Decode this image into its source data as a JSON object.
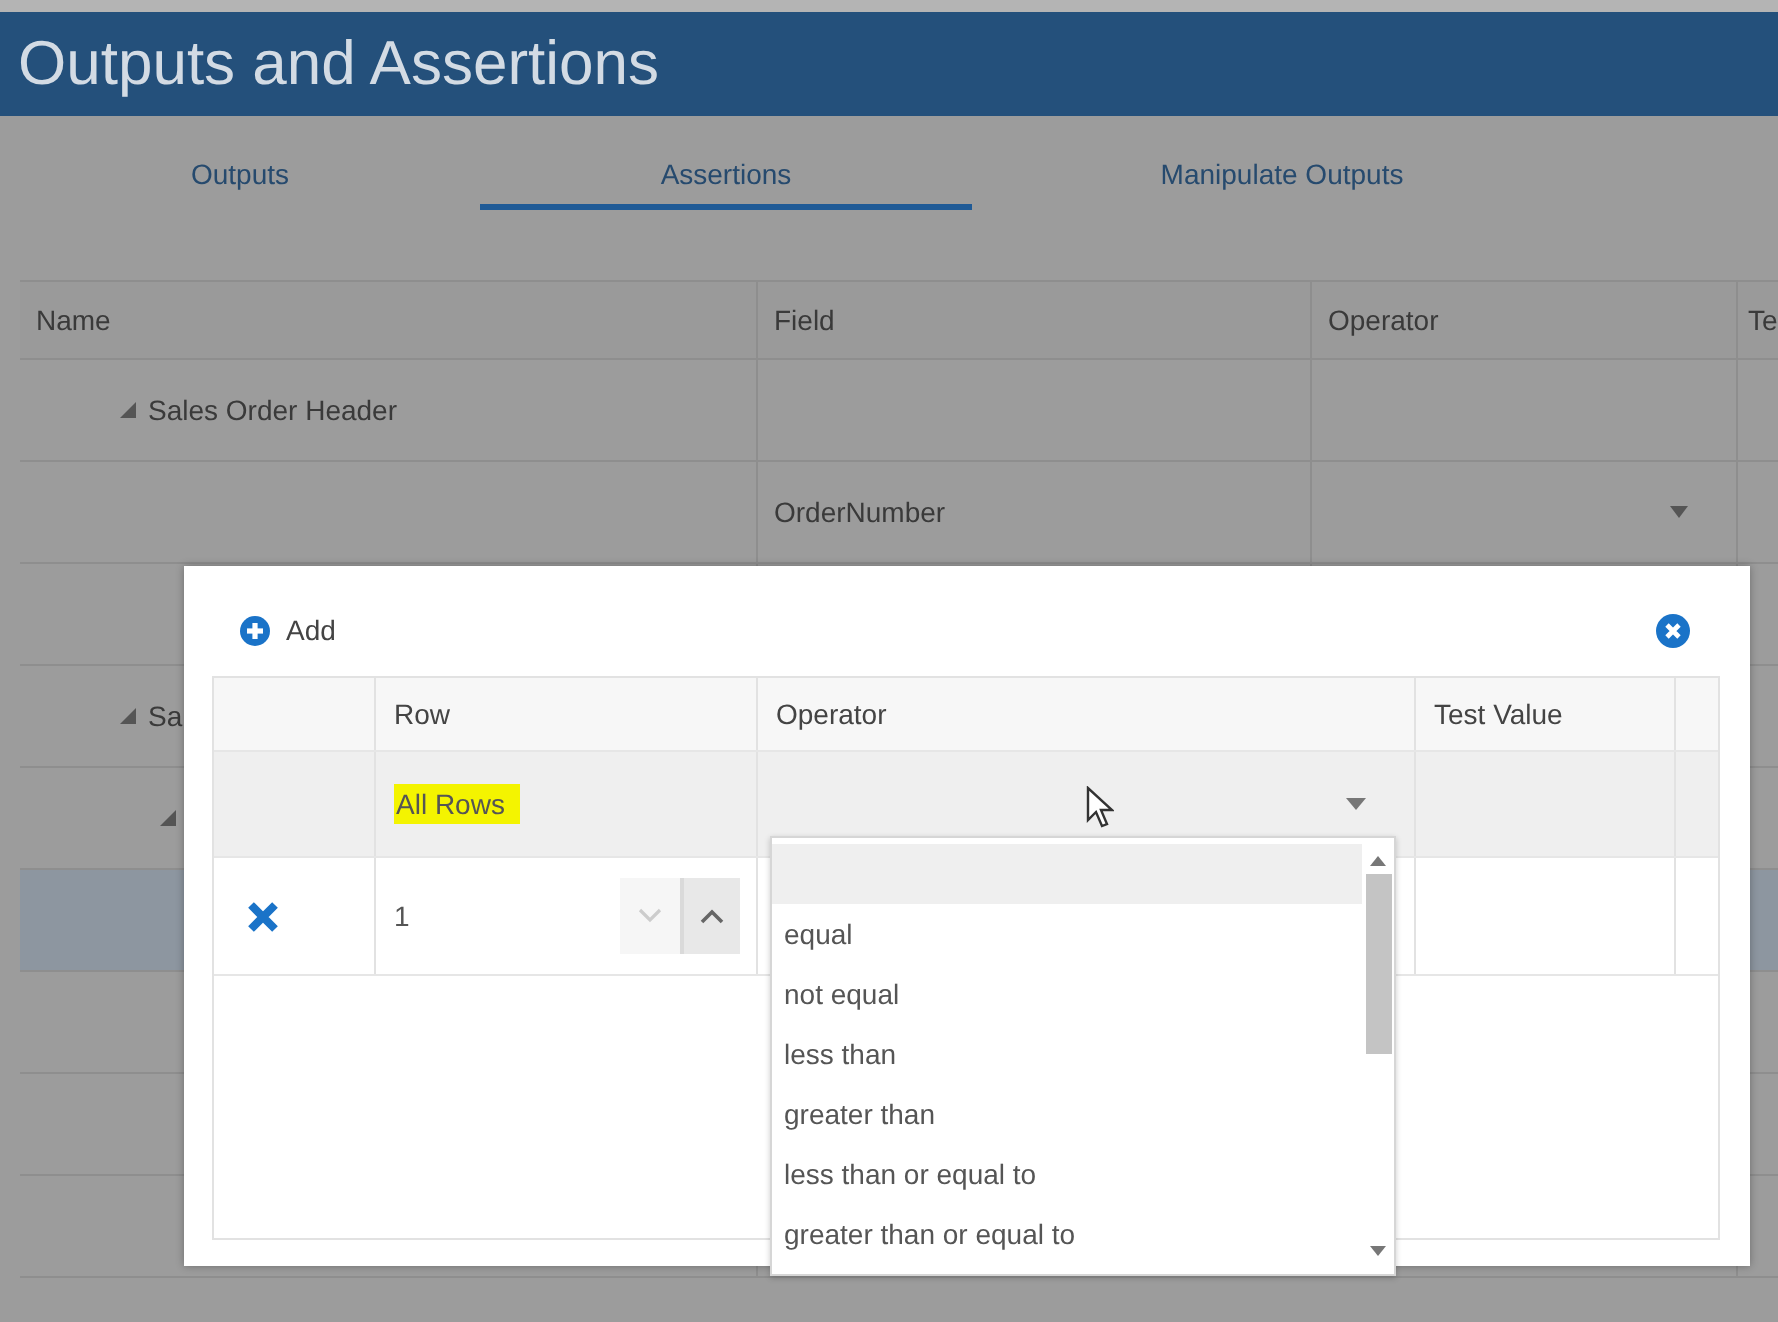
{
  "window": {
    "title": "Outputs and Assertions"
  },
  "tabs": [
    {
      "label": "Outputs",
      "selected": false
    },
    {
      "label": "Assertions",
      "selected": true
    },
    {
      "label": "Manipulate Outputs",
      "selected": false
    }
  ],
  "table": {
    "columns": [
      "Name",
      "Field",
      "Operator",
      "Te"
    ],
    "rows": [
      {
        "kind": "group",
        "name": "Sales Order Header",
        "expanded": true,
        "children": [
          {
            "kind": "field",
            "field": "OrderNumber",
            "operator_dropdown": true,
            "selected": false
          },
          {
            "kind": "field",
            "selected": false
          }
        ]
      },
      {
        "kind": "group",
        "name": "Sa",
        "expanded": true,
        "children": [
          {
            "kind": "group",
            "expanded": true,
            "children": [
              {
                "kind": "field",
                "selected": true
              },
              {
                "kind": "field",
                "selected": false
              },
              {
                "kind": "field",
                "selected": false
              },
              {
                "kind": "field",
                "selected": false
              }
            ]
          }
        ]
      }
    ]
  },
  "dialog": {
    "add_label": "Add",
    "columns": [
      "Row",
      "Operator",
      "Test Value"
    ],
    "rows": [
      {
        "kind": "filter",
        "row": "All Rows",
        "highlighted": true
      },
      {
        "kind": "entry",
        "row": "1"
      }
    ],
    "operator_options": [
      {
        "selected": true
      },
      {
        "label": "equal",
        "selected": false
      },
      {
        "label": "not equal",
        "selected": false
      },
      {
        "label": "less than",
        "selected": false
      },
      {
        "label": "greater than",
        "selected": false
      },
      {
        "label": "less than or equal to",
        "selected": false
      },
      {
        "label": "greater than or equal to",
        "selected": false
      }
    ]
  }
}
